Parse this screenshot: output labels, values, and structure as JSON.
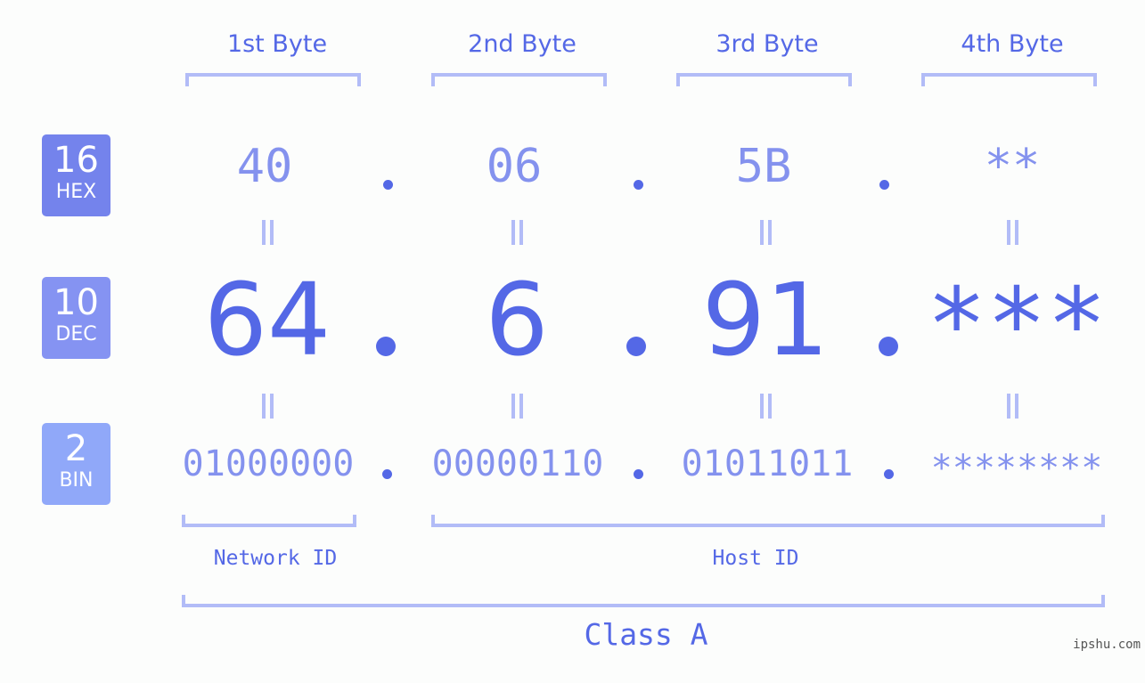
{
  "badges": [
    {
      "base": "16",
      "label": "HEX",
      "color": "#7483ec"
    },
    {
      "base": "10",
      "label": "DEC",
      "color": "#8593f2"
    },
    {
      "base": "2",
      "label": "BIN",
      "color": "#90a8f9"
    }
  ],
  "bytes": [
    {
      "title": "1st Byte",
      "hex": "40",
      "dec": "64",
      "bin": "01000000"
    },
    {
      "title": "2nd Byte",
      "hex": "06",
      "dec": "6",
      "bin": "00000110"
    },
    {
      "title": "3rd Byte",
      "hex": "5B",
      "dec": "91",
      "bin": "01011011"
    },
    {
      "title": "4th Byte",
      "hex": "**",
      "dec": "***",
      "bin": "********"
    }
  ],
  "network_label": "Network ID",
  "host_label": "Host ID",
  "class_label": "Class A",
  "watermark": "ipshu.com",
  "colors": {
    "primary": "#5468e6",
    "secondary": "#8492ee",
    "bracket": "#b2bcf7"
  }
}
